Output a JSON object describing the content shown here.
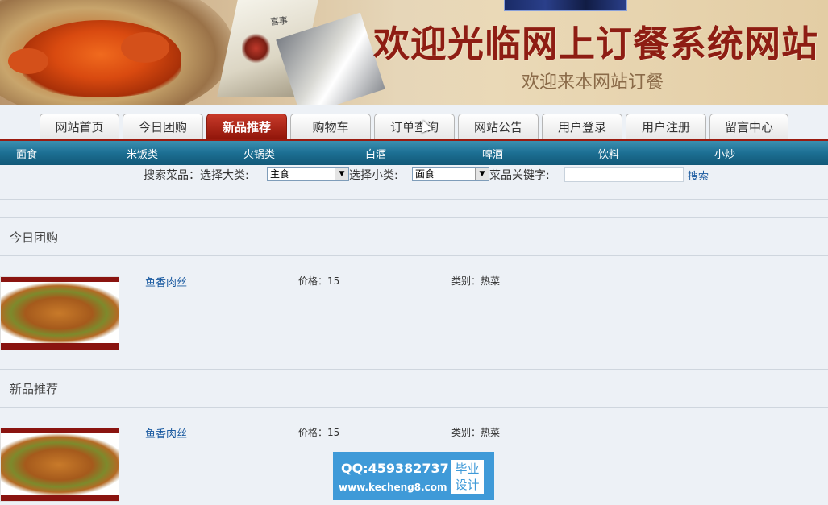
{
  "banner": {
    "title": "欢迎光临网上订餐系统网站",
    "subtitle": "欢迎来本网站订餐",
    "stamp_text": "喜事"
  },
  "tabs": [
    {
      "label": "网站首页"
    },
    {
      "label": "今日团购"
    },
    {
      "label": "新品推荐",
      "active": true
    },
    {
      "label": "购物车"
    },
    {
      "label": "订单查询"
    },
    {
      "label": "网站公告"
    },
    {
      "label": "用户登录"
    },
    {
      "label": "用户注册"
    },
    {
      "label": "留言中心"
    }
  ],
  "categories": [
    "面食",
    "米饭类",
    "火锅类",
    "白酒",
    "啤酒",
    "饮料",
    "小炒"
  ],
  "search": {
    "label_dish": "搜索菜品：选择大类:",
    "major_selected": "主食",
    "label_minor": "选择小类:",
    "minor_selected": "面食",
    "label_keyword": "菜品关键字:",
    "keyword_value": "",
    "search_link": "搜索"
  },
  "sections": [
    {
      "title": "今日团购",
      "items": [
        {
          "name": "鱼香肉丝",
          "price": "价格：15",
          "category": "类别：热菜"
        }
      ]
    },
    {
      "title": "新品推荐",
      "items": [
        {
          "name": "鱼香肉丝",
          "price": "价格：15",
          "category": "类别：热菜"
        }
      ]
    }
  ],
  "watermark": {
    "qq": "QQ:459382737",
    "url": "www.kecheng8.com",
    "badge_line1": "毕业",
    "badge_line2": "设计"
  },
  "colors": {
    "active_tab": "#9a1b10",
    "category_bar": "#1c6f93",
    "link": "#1a5aa0",
    "watermark_bg": "#3f9ad8"
  }
}
